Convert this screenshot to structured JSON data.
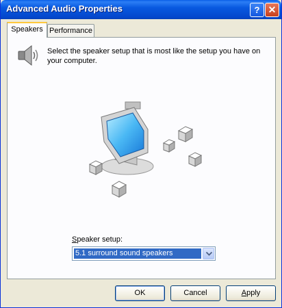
{
  "window": {
    "title": "Advanced Audio Properties",
    "help_glyph": "?",
    "close_glyph": "✕"
  },
  "tabs": [
    {
      "label": "Speakers",
      "selected": true
    },
    {
      "label": "Performance",
      "selected": false
    }
  ],
  "speakers_tab": {
    "description": "Select the speaker setup that is most like the setup you have on your computer.",
    "setup_label_underlined": "S",
    "setup_label_rest": "peaker setup:",
    "setup_selected": "5.1 surround sound speakers"
  },
  "buttons": {
    "ok": "OK",
    "cancel": "Cancel",
    "apply_underlined": "A",
    "apply_rest": "pply"
  },
  "colors": {
    "title_bar": "#0447cc",
    "selection": "#316ac5",
    "tab_highlight": "#ffc83c",
    "dialog_bg": "#ece9d8"
  }
}
